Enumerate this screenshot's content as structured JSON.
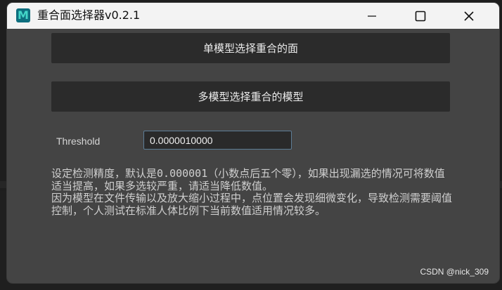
{
  "window": {
    "title": "重合面选择器v0.2.1",
    "icon": "maya-icon"
  },
  "buttons": {
    "single_model": "单模型选择重合的面",
    "multi_model": "多模型选择重合的模型"
  },
  "threshold": {
    "label": "Threshold",
    "value": "0.0000010000"
  },
  "description": {
    "para1": "设定检测精度，默认是0.000001（小数点后五个零），如果出现漏选的情况可将数值适当提高，如果多选较严重，请适当降低数值。",
    "para2": "因为模型在文件传输以及放大缩小过程中，点位置会发现细微变化，导致检测需要阈值控制，个人测试在标准人体比例下当前数值适用情况较多。"
  },
  "watermark": "CSDN @nick_309",
  "colors": {
    "window_bg": "#444444",
    "button_bg": "#2b2b2b",
    "input_border": "#5d7d96",
    "titlebar_bg": "#f3f3f3"
  }
}
